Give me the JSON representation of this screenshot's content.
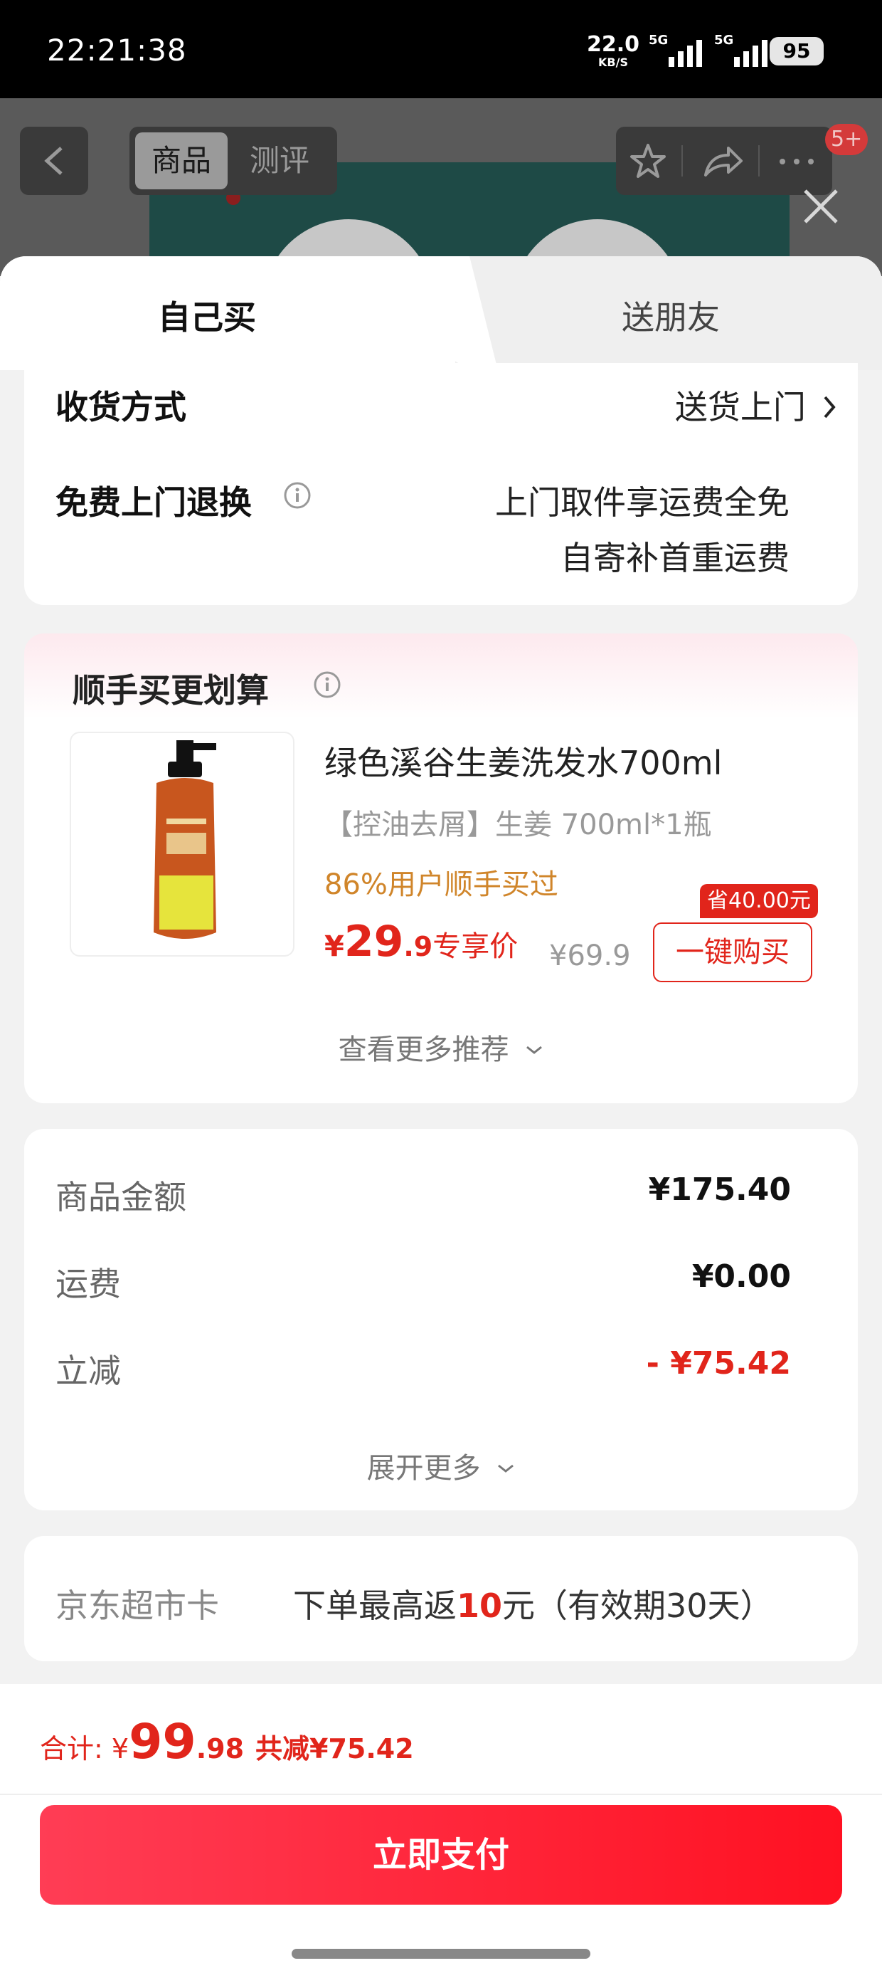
{
  "status_bar": {
    "time": "22:21:38",
    "rate_num": "22.0",
    "rate_unit": "KB/S",
    "sim1_tag": "5G",
    "sim2_tag": "5G",
    "battery": "95"
  },
  "header": {
    "seg_product": "商品",
    "seg_review": "测评",
    "badge": "5+"
  },
  "tabs": {
    "self": "自己买",
    "gift": "送朋友"
  },
  "delivery": {
    "method_label": "收货方式",
    "method_value": "送货上门",
    "return_label": "免费上门退换",
    "return_line1": "上门取件享运费全免",
    "return_line2": "自寄补首重运费"
  },
  "addon": {
    "title": "顺手买更划算",
    "product_name": "绿色溪谷生姜洗发水700ml",
    "product_spec": "【控油去屑】生姜 700ml*1瓶",
    "popularity": "86%用户顺手买过",
    "price_yen": "¥",
    "price_int": "29",
    "price_dec": ".9",
    "price_tag": "专享价",
    "original_price": "¥69.9",
    "save_tag": "省40.00元",
    "buy_button": "一键购买",
    "more": "查看更多推荐"
  },
  "summary": {
    "rows": [
      {
        "label": "商品金额",
        "value": "¥175.40"
      },
      {
        "label": "运费",
        "value": "¥0.00"
      },
      {
        "label": "立减",
        "value": "- ¥75.42"
      }
    ],
    "expand": "展开更多"
  },
  "supermarket_card": {
    "label": "京东超市卡",
    "desc_prefix": "下单最高返",
    "desc_amount": "10",
    "desc_suffix": "元（有效期30天）"
  },
  "footer": {
    "total_label": "合计: ",
    "total_yen": "¥",
    "total_int": "99",
    "total_dec": ".98",
    "total_cut": "共减¥75.42",
    "pay_button": "立即支付"
  },
  "colors": {
    "accent_red": "#e1251b",
    "popularity_orange": "#d0852a"
  }
}
